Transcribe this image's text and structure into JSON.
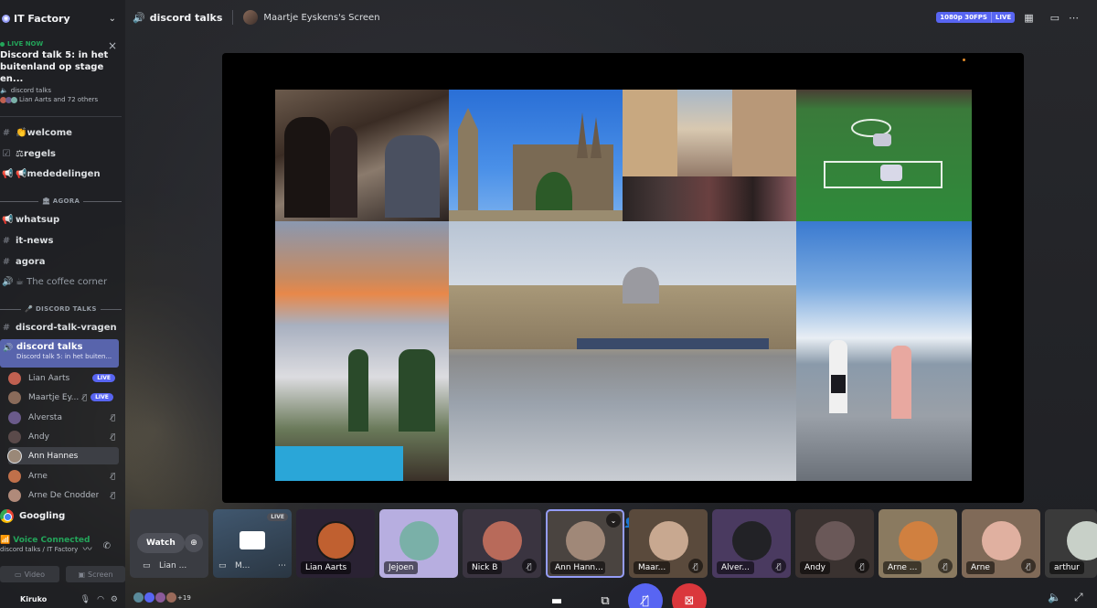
{
  "server": {
    "name": "IT Factory"
  },
  "live_now": {
    "badge": "LIVE NOW",
    "title": "Discord talk 5: in het buitenland op stage en...",
    "channel": "discord talks",
    "attendees": "Lian Aarts and 72 others"
  },
  "channels_top": [
    {
      "icon": "#",
      "label": "👏welcome"
    },
    {
      "icon": "☑",
      "label": "⚖regels"
    },
    {
      "icon": "📢",
      "label": "📢mededelingen"
    }
  ],
  "category_agora": "🏛 AGORA",
  "channels_agora": [
    {
      "icon": "📢",
      "label": "whatsup"
    },
    {
      "icon": "#",
      "label": "it-news"
    },
    {
      "icon": "#",
      "label": "agora"
    },
    {
      "icon": "🔊",
      "label": "☕ The coffee corner"
    }
  ],
  "category_talks": "🎤 DISCORD TALKS",
  "channel_vragen": {
    "icon": "#",
    "label": "discord-talk-vragen"
  },
  "active_channel": {
    "title": "discord talks",
    "subtitle": "Discord talk 5: in het buiten..."
  },
  "members": [
    {
      "name": "Lian Aarts",
      "badge": "LIVE",
      "color": "#c06050"
    },
    {
      "name": "Maartje Ey...",
      "badge": "LIVE",
      "mute": "🎙̸",
      "color": "#8a6b5a"
    },
    {
      "name": "Alversta",
      "mute": "🎙̸",
      "color": "#6a5a8a"
    },
    {
      "name": "Andy",
      "mute": "🎙̸",
      "color": "#5a4a4a"
    },
    {
      "name": "Ann Hannes",
      "color": "#9a8878"
    },
    {
      "name": "Arne",
      "mute": "🎙̸",
      "color": "#c0704a"
    },
    {
      "name": "Arne De Cnodder",
      "mute": "🎙̸",
      "color": "#b08a7a"
    }
  ],
  "activity": {
    "label": "Googling"
  },
  "voice": {
    "status": "Voice Connected",
    "location": "discord talks / IT Factory",
    "video_label": "Video",
    "screen_label": "Screen"
  },
  "user": {
    "name": "Kiruko"
  },
  "topbar": {
    "channel": "discord talks",
    "screen_owner": "Maartje Eyskens's Screen",
    "quality": "1080p 30FPS",
    "live": "LIVE"
  },
  "participants": [
    {
      "name": "Lian ...",
      "type": "watch",
      "watch_label": "Watch"
    },
    {
      "name": "M...",
      "type": "live",
      "live_label": "LIVE"
    },
    {
      "name": "Lian Aarts",
      "bg": "#2a2233",
      "av": "#c06030"
    },
    {
      "name": "Jejoen",
      "bg": "#b7aee0",
      "av": "#7ab0a8"
    },
    {
      "name": "Nick B",
      "bg": "#3a3440",
      "av": "#b86a5a",
      "mute": "🎙̸"
    },
    {
      "name": "Ann Hann...",
      "bg": "#4a4440",
      "av": "#a08878",
      "selected": true
    },
    {
      "name": "Maar...",
      "bg": "#5a4a3c",
      "av": "#c8a890",
      "mute": "🎙̸"
    },
    {
      "name": "Alver...",
      "bg": "#4a3a60",
      "av": "#222226",
      "mute": "🎙̸"
    },
    {
      "name": "Andy",
      "bg": "#3a3230",
      "av": "#6a5858",
      "mute": "🎙̸"
    },
    {
      "name": "Arne ...",
      "bg": "#8a7a60",
      "av": "#d08040",
      "mute": "🎙̸"
    },
    {
      "name": "Arne",
      "bg": "#806a58",
      "av": "#e0b0a0",
      "mute": "🎙̸"
    },
    {
      "name": "arthur",
      "bg": "#3a3a3a",
      "av": "#c8d0c8"
    }
  ],
  "reactions_count": "+19",
  "colors": {
    "accent": "#5865f2",
    "online": "#23a55a",
    "danger": "#da373c"
  }
}
